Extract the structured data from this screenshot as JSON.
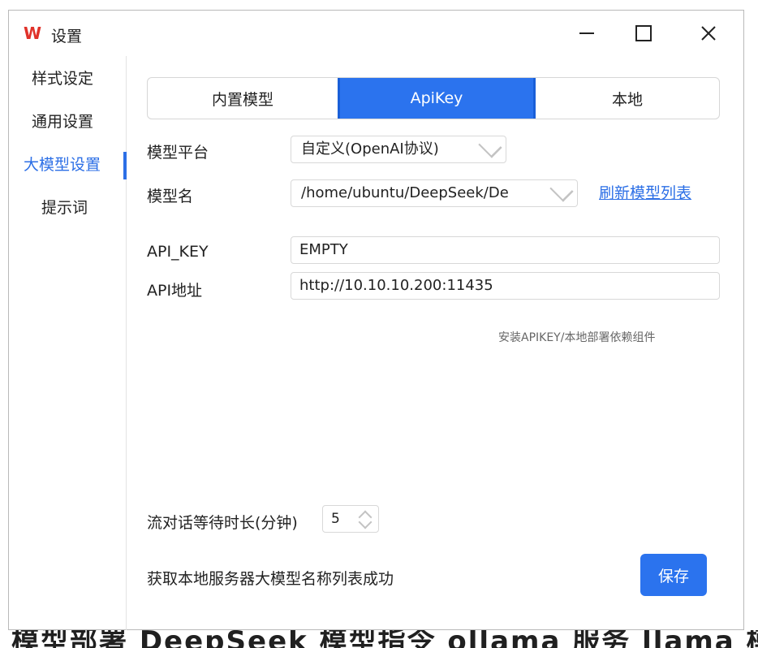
{
  "window": {
    "title": "设置",
    "logo_glyph": "W"
  },
  "titlebar_icons": [
    "minimize-icon",
    "maximize-icon",
    "close-icon"
  ],
  "sidebar": {
    "items": [
      {
        "label": "样式设定"
      },
      {
        "label": "通用设置"
      },
      {
        "label": "大模型设置"
      },
      {
        "label": "提示词"
      }
    ],
    "active": "大模型设置"
  },
  "tabs": [
    {
      "label": "内置模型"
    },
    {
      "label": "ApiKey"
    },
    {
      "label": "本地"
    }
  ],
  "active_tab": "ApiKey",
  "form": {
    "platform_label": "模型平台",
    "platform_value": "自定义(OpenAI协议)",
    "model_label": "模型名",
    "model_value": "/home/ubuntu/DeepSeek/De",
    "refresh_link": "刷新模型列表",
    "api_key_label": "API_KEY",
    "api_key_value": "EMPTY",
    "api_url_label": "API地址",
    "api_url_value": "http://10.10.10.200:11435",
    "install_hint": "安装APIKEY/本地部署依赖组件",
    "stream_wait_label": "流对话等待时长(分钟)",
    "stream_wait_value": "5"
  },
  "status_text": "获取本地服务器大模型名称列表成功",
  "save_label": "保存",
  "colors": {
    "accent": "#2b73ee",
    "logo": "#e0322a"
  }
}
